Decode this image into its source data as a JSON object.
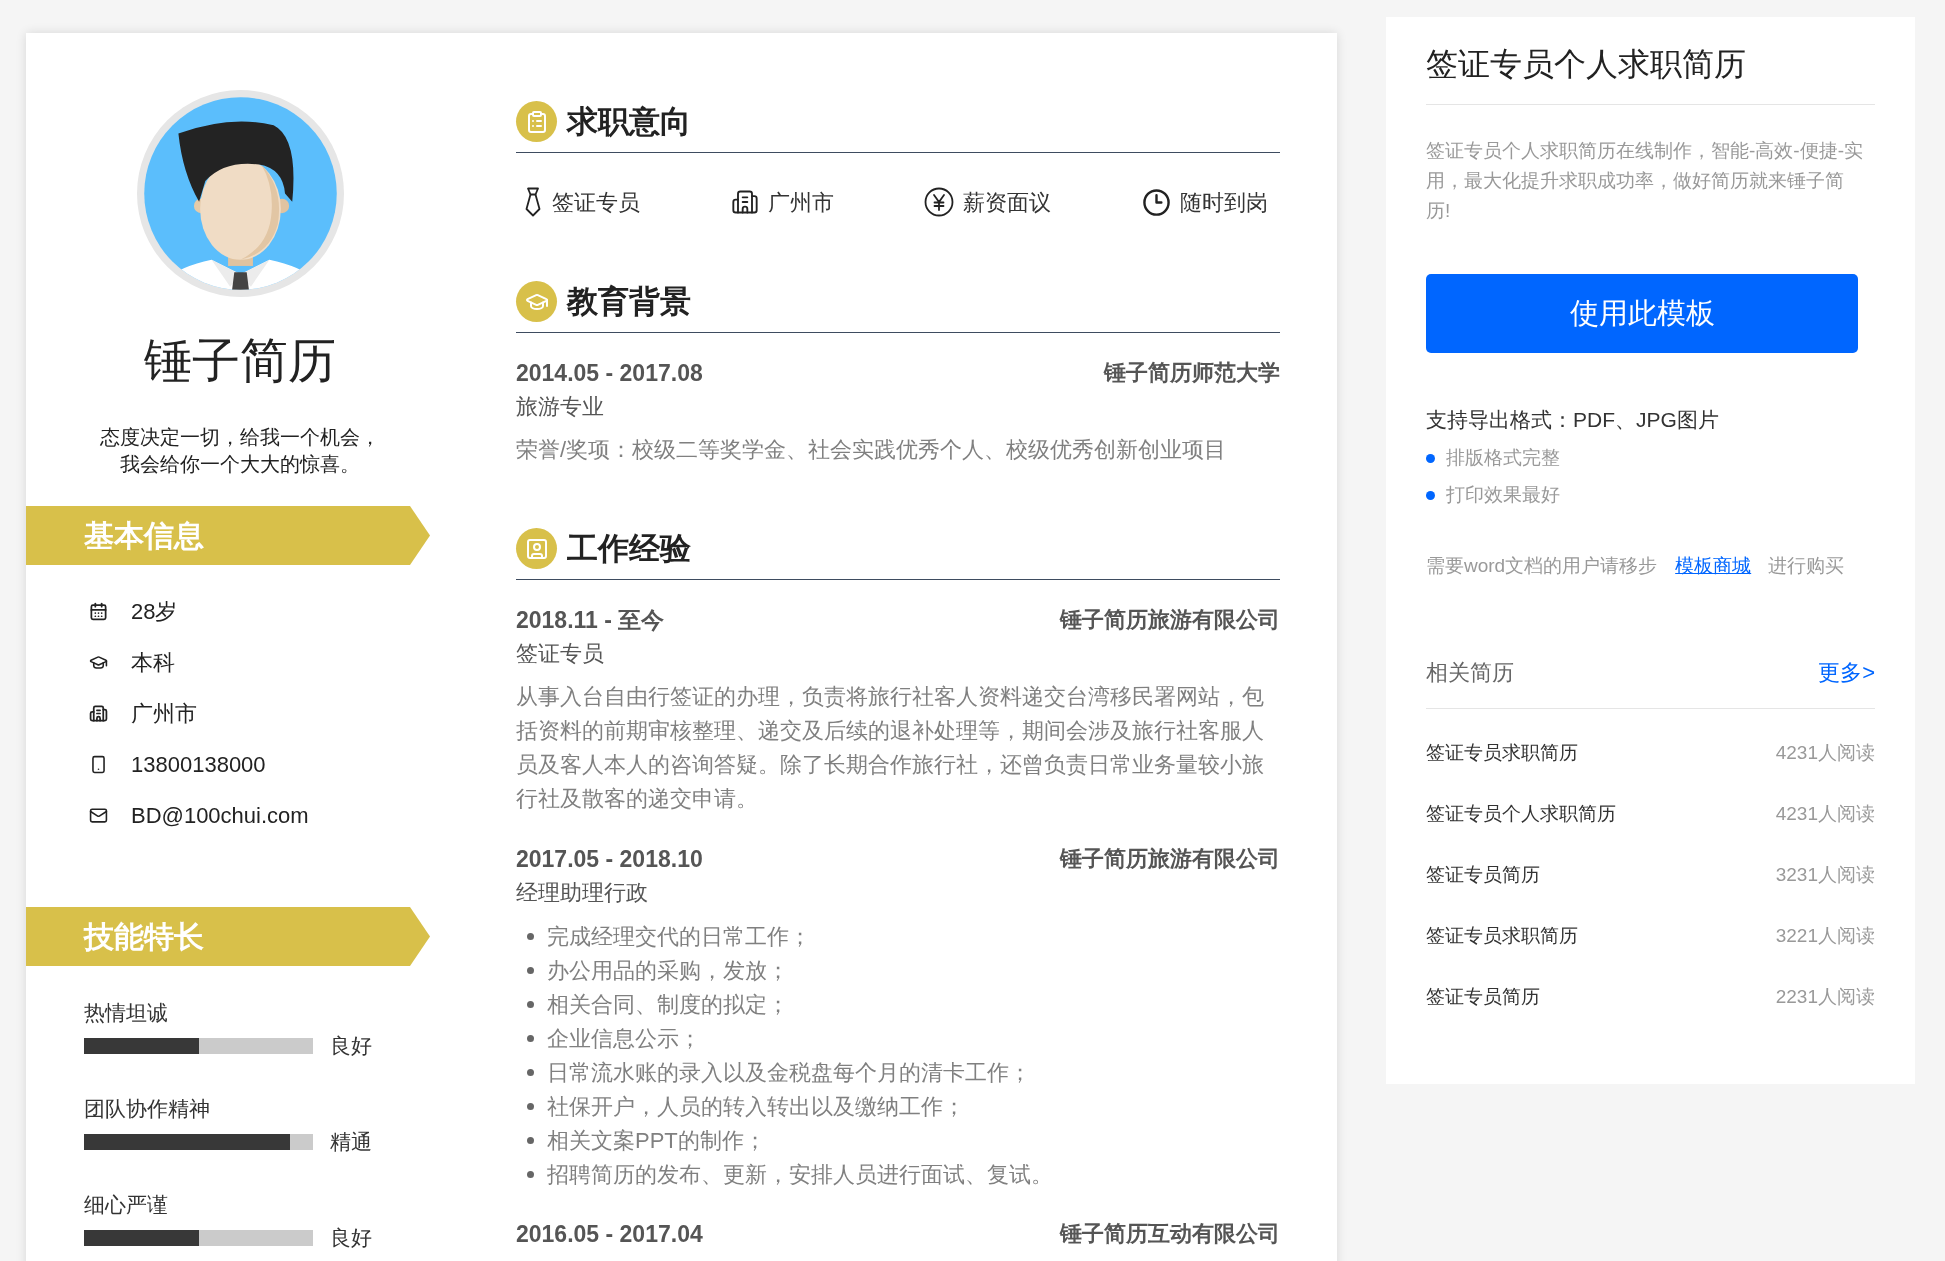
{
  "profile": {
    "name": "锤子简历",
    "motto": "态度决定一切，给我一个机会，我会给你一个大大的惊喜。"
  },
  "basic_info": {
    "title": "基本信息",
    "items": [
      {
        "kind": "age",
        "text": "28岁"
      },
      {
        "kind": "education",
        "text": "本科"
      },
      {
        "kind": "city",
        "text": "广州市"
      },
      {
        "kind": "phone",
        "text": "13800138000"
      },
      {
        "kind": "email",
        "text": "BD@100chui.com"
      }
    ]
  },
  "skills": {
    "title": "技能特长",
    "items": [
      {
        "name": "热情坦诚",
        "level": 0.5,
        "rating": "良好"
      },
      {
        "name": "团队协作精神",
        "level": 0.9,
        "rating": "精通"
      },
      {
        "name": "细心严谨",
        "level": 0.5,
        "rating": "良好"
      }
    ]
  },
  "sections": [
    {
      "kind": "intent",
      "title": "求职意向",
      "items": [
        {
          "kind": "position",
          "text": "签证专员"
        },
        {
          "kind": "city",
          "text": "广州市"
        },
        {
          "kind": "salary",
          "text": "薪资面议"
        },
        {
          "kind": "availability",
          "text": "随时到岗"
        }
      ]
    },
    {
      "kind": "education",
      "title": "教育背景",
      "entries": [
        {
          "period": "2014.05 - 2017.08",
          "organization": "锤子简历师范大学",
          "subtitle": "旅游专业",
          "description": "荣誉/奖项：校级二等奖学金、社会实践优秀个人、校级优秀创新创业项目"
        }
      ]
    },
    {
      "kind": "work",
      "title": "工作经验",
      "entries": [
        {
          "period": "2018.11 - 至今",
          "organization": "锤子简历旅游有限公司",
          "subtitle": "签证专员",
          "description": "从事入台自由行签证的办理，负责将旅行社客人资料递交台湾移民署网站，包括资料的前期审核整理、递交及后续的退补处理等，期间会涉及旅行社客服人员及客人本人的咨询答疑。除了长期合作旅行社，还曾负责日常业务量较小旅行社及散客的递交申请。"
        },
        {
          "period": "2017.05 - 2018.10",
          "organization": "锤子简历旅游有限公司",
          "subtitle": "经理助理行政",
          "duties": [
            "完成经理交代的日常工作；",
            "办公用品的采购，发放；",
            "相关合同、制度的拟定；",
            "企业信息公示；",
            "日常流水账的录入以及金税盘每个月的清卡工作；",
            "社保开户，人员的转入转出以及缴纳工作；",
            "相关文案PPT的制作；",
            "招聘简历的发布、更新，安排人员进行面试、复试。"
          ]
        },
        {
          "period": "2016.05 - 2017.04",
          "organization": "锤子简历互动有限公司"
        }
      ]
    }
  ],
  "side_panel": {
    "title": "签证专员个人求职简历",
    "description": "签证专员个人求职简历在线制作，智能-高效-便捷-实用，最大化提升求职成功率，做好简历就来锤子简历!",
    "button": "使用此模板",
    "export_formats": "支持导出格式：PDF、JPG图片",
    "features": [
      "排版格式完整",
      "打印效果最好"
    ],
    "word_note": {
      "before": "需要word文档的用户请移步",
      "link": "模板商城",
      "after": "进行购买"
    },
    "related": {
      "title": "相关简历",
      "more": "更多>",
      "items": [
        {
          "title": "签证专员求职简历",
          "reads": "4231人阅读"
        },
        {
          "title": "签证专员个人求职简历",
          "reads": "4231人阅读"
        },
        {
          "title": "签证专员简历",
          "reads": "3231人阅读"
        },
        {
          "title": "签证专员求职简历",
          "reads": "3221人阅读"
        },
        {
          "title": "签证专员简历",
          "reads": "2231人阅读"
        }
      ]
    }
  }
}
